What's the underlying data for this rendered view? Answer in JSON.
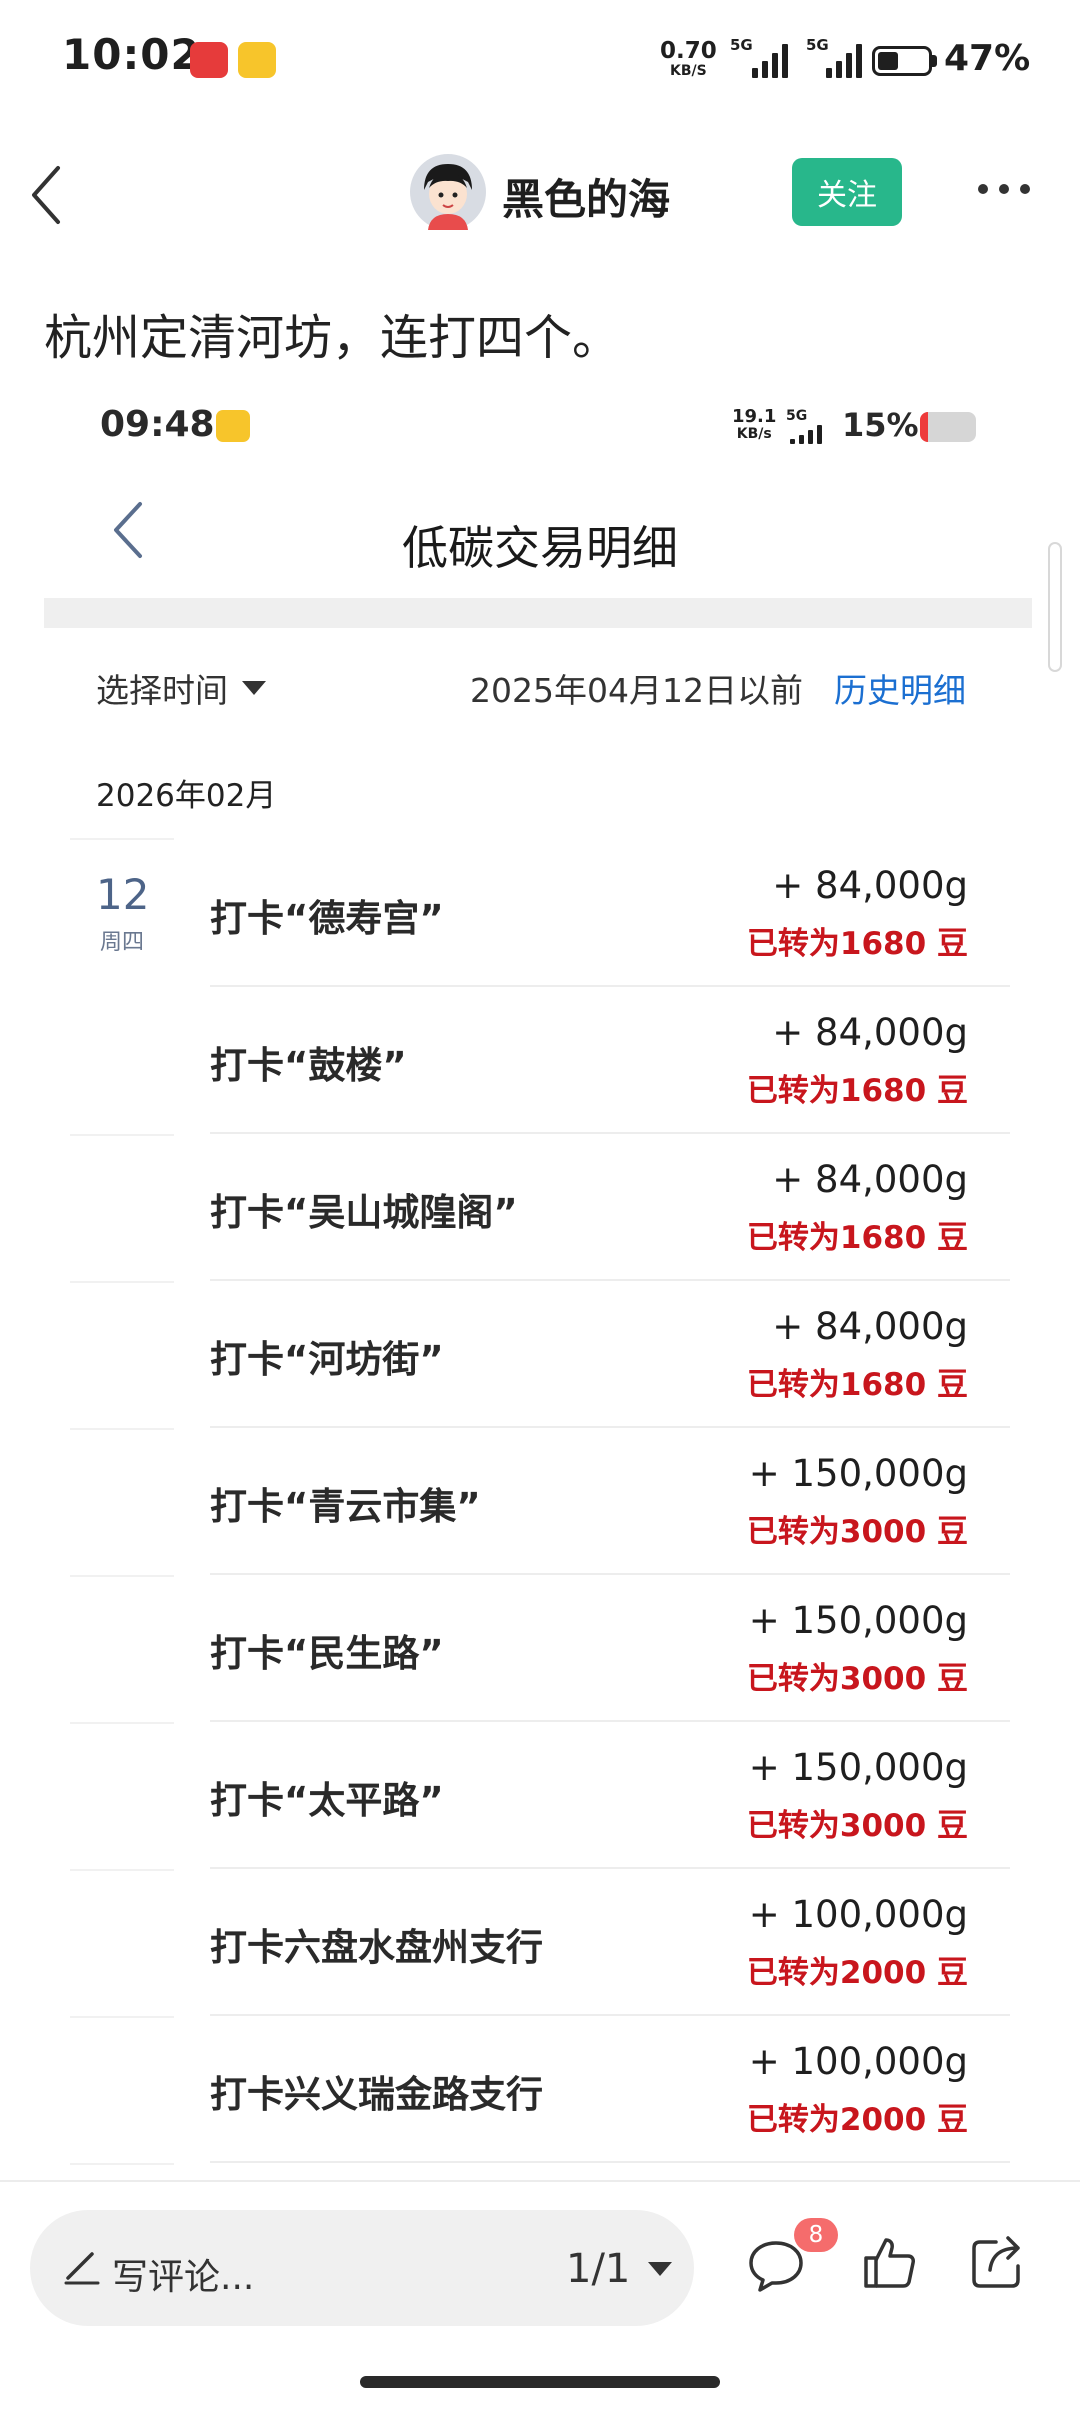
{
  "status_bar": {
    "time": "10:02",
    "net_speed": "0.70",
    "net_unit": "KB/S",
    "net_type_1": "5G",
    "net_type_2": "5G",
    "battery": "47%",
    "battery_level": 0.47
  },
  "post_header": {
    "author": "黑色的海",
    "follow_label": "关注"
  },
  "post_text": "杭州定清河坊，连打四个。",
  "screenshot": {
    "status_bar": {
      "time": "09:48",
      "net_speed": "19.1",
      "net_unit": "KB/s",
      "net_type": "5G",
      "battery": "15%",
      "battery_level": 0.15
    },
    "title": "低碳交易明细",
    "select_time_label": "选择时间",
    "before_text": "2025年04月12日以前",
    "history_link": "历史明细",
    "month": "2026年02月",
    "day_num": "12",
    "day_weekday": "周四",
    "entries": [
      {
        "label": "打卡“德寿宫”",
        "amount": "+ 84,000g",
        "beans": "已转为1680 豆"
      },
      {
        "label": "打卡“鼓楼”",
        "amount": "+ 84,000g",
        "beans": "已转为1680 豆"
      },
      {
        "label": "打卡“吴山城隍阁”",
        "amount": "+ 84,000g",
        "beans": "已转为1680 豆"
      },
      {
        "label": "打卡“河坊街”",
        "amount": "+ 84,000g",
        "beans": "已转为1680 豆"
      },
      {
        "label": "打卡“青云市集”",
        "amount": "+ 150,000g",
        "beans": "已转为3000 豆"
      },
      {
        "label": "打卡“民生路”",
        "amount": "+ 150,000g",
        "beans": "已转为3000 豆"
      },
      {
        "label": "打卡“太平路”",
        "amount": "+ 150,000g",
        "beans": "已转为3000 豆"
      },
      {
        "label": "打卡六盘水盘州支行",
        "amount": "+ 100,000g",
        "beans": "已转为2000 豆"
      },
      {
        "label": "打卡兴义瑞金路支行",
        "amount": "+ 100,000g",
        "beans": "已转为2000 豆"
      }
    ]
  },
  "bottom_bar": {
    "comment_placeholder": "写评论...",
    "page_indicator": "1/1",
    "comment_count": "8"
  },
  "colors": {
    "follow_green": "#28b78b",
    "link_blue": "#1b6fd1",
    "bean_red": "#c8161d",
    "badge_red": "#f56c6c"
  },
  "icons": [
    "back-arrow-icon",
    "more-icon",
    "pencil-icon",
    "caret-down-icon",
    "comment-icon",
    "like-icon",
    "share-icon"
  ]
}
